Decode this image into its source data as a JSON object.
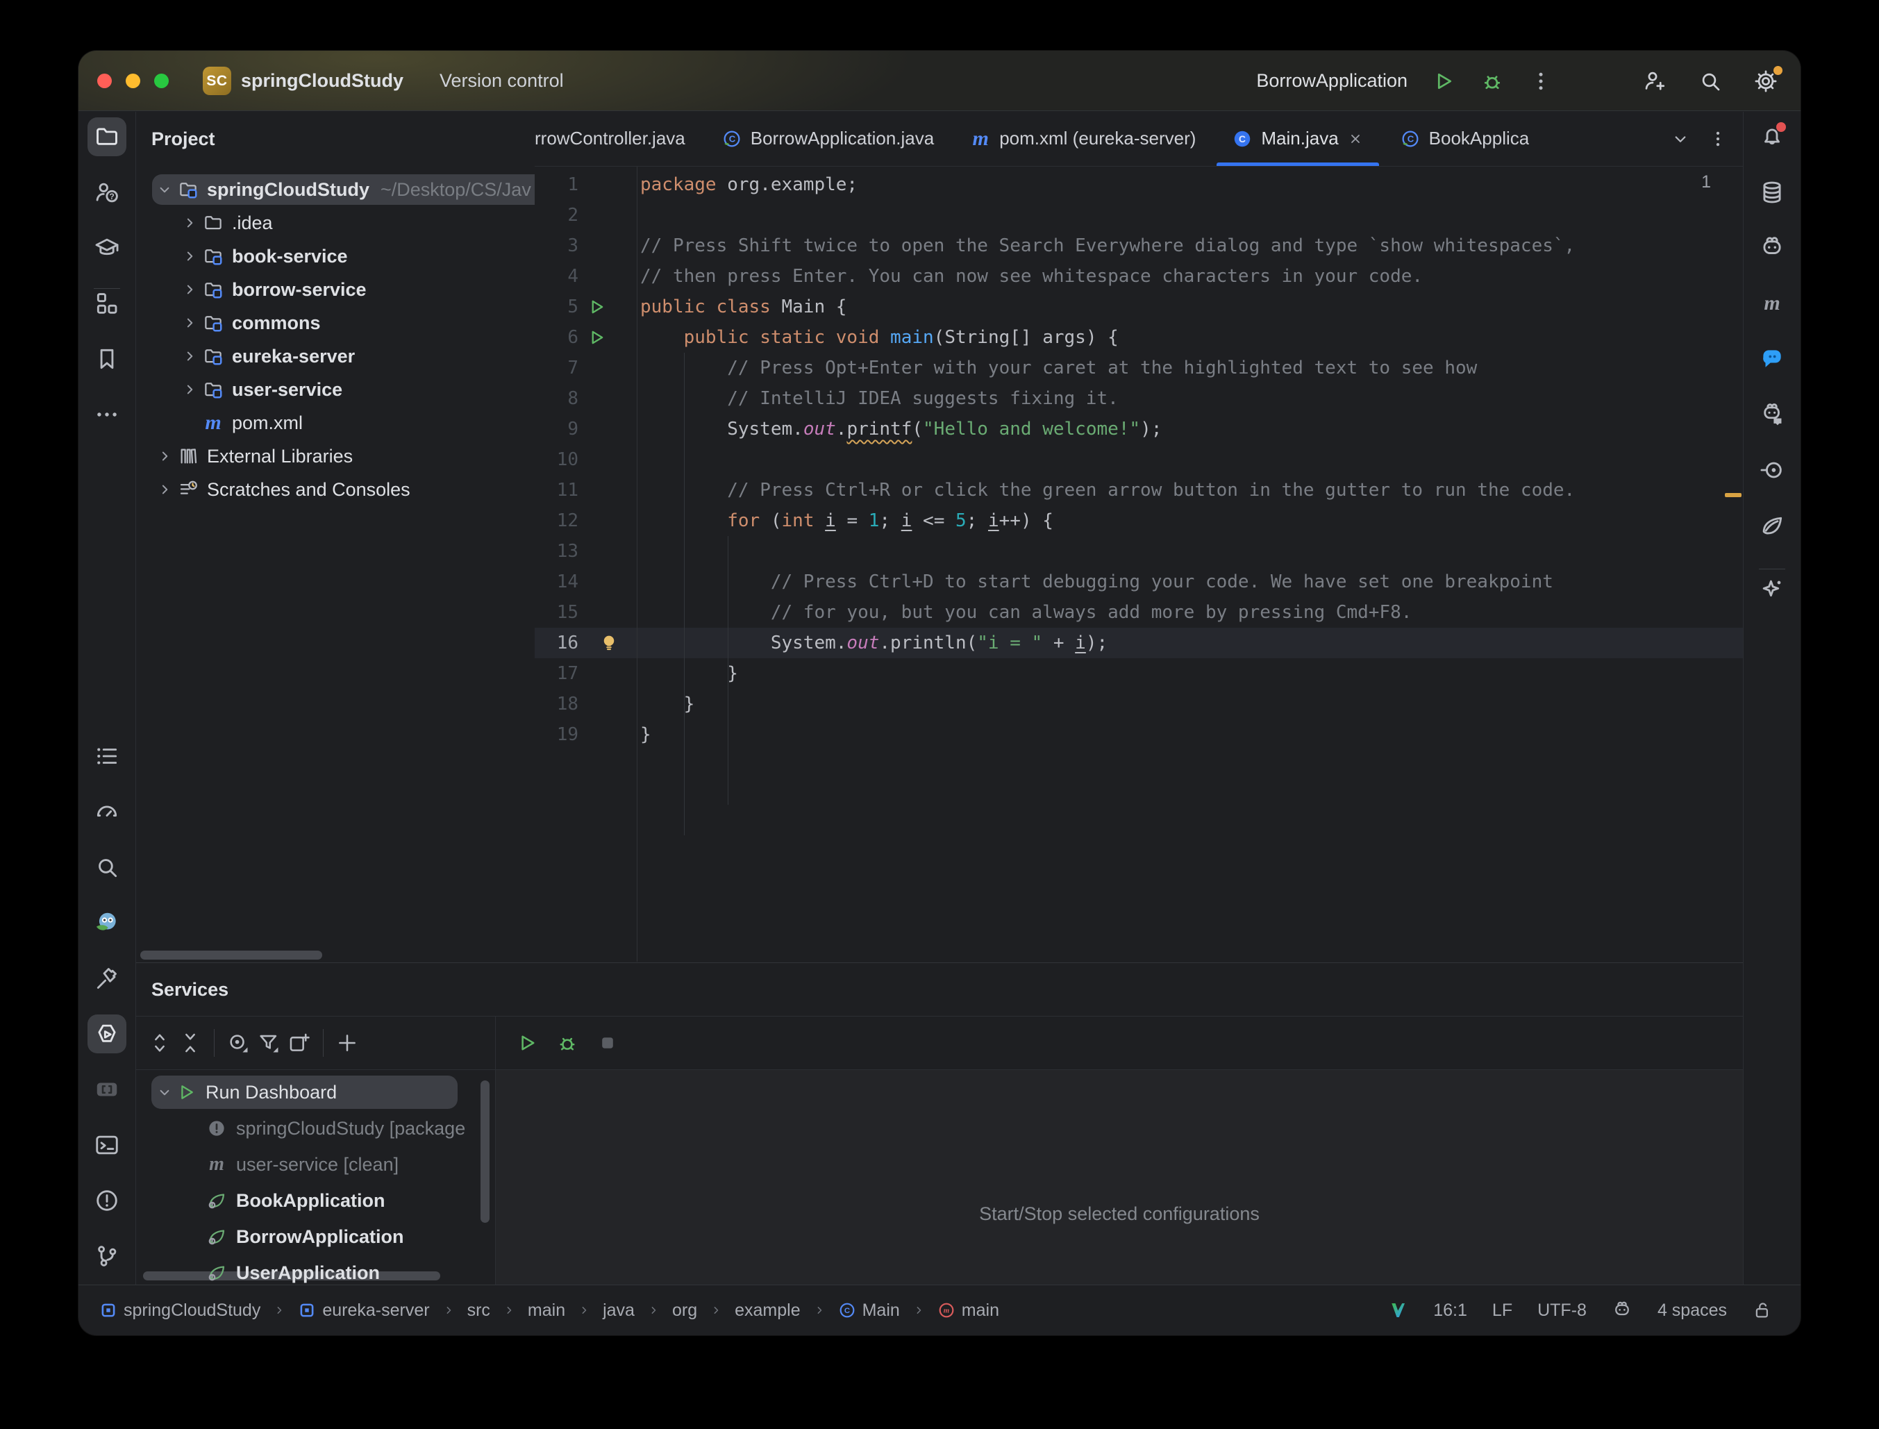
{
  "title_bar": {
    "traffic_lights": [
      {
        "name": "close",
        "color": "#ff5f57"
      },
      {
        "name": "minimize",
        "color": "#febc2e"
      },
      {
        "name": "zoom",
        "color": "#28c840"
      }
    ],
    "project_badge": "SC",
    "project_name": "springCloudStudy",
    "version_control_label": "Version control",
    "run_config_name": "BorrowApplication",
    "run_controls": [
      "play",
      "debug",
      "kebab"
    ],
    "right_controls": [
      "user-plus",
      "search",
      "settings"
    ]
  },
  "left_strip": {
    "top": [
      {
        "icon": "folder",
        "active": true
      },
      {
        "icon": "user-question"
      },
      {
        "icon": "graduation-cap"
      },
      {
        "icon": "divider"
      },
      {
        "icon": "structure"
      },
      {
        "icon": "bookmark"
      },
      {
        "icon": "more"
      }
    ],
    "bottom": [
      {
        "icon": "todo-list"
      },
      {
        "icon": "gauge"
      },
      {
        "icon": "find"
      },
      {
        "icon": "owl-plugin"
      },
      {
        "icon": "build-hammer"
      },
      {
        "icon": "services-play",
        "active": true
      },
      {
        "icon": "brackets"
      },
      {
        "icon": "terminal"
      },
      {
        "icon": "problems"
      },
      {
        "icon": "git-branch"
      }
    ]
  },
  "right_strip": {
    "icons": [
      {
        "icon": "notifications-bell",
        "badge": "#e35252"
      },
      {
        "icon": "database"
      },
      {
        "icon": "ai-robot"
      },
      {
        "icon": "maven"
      },
      {
        "icon": "chat-bubble",
        "accent": "#2e9ef7"
      },
      {
        "icon": "robot-chat"
      },
      {
        "icon": "endpoints"
      },
      {
        "icon": "spring-leaf-outline"
      },
      {
        "icon": "divider"
      },
      {
        "icon": "ai-sparkle"
      }
    ]
  },
  "project_panel": {
    "header": "Project",
    "tree": [
      {
        "label": "springCloudStudy",
        "path": "~/Desktop/CS/Jav",
        "icon": "module-folder",
        "chevron": "down",
        "selected": true,
        "bold": true,
        "indent": 0
      },
      {
        "label": ".idea",
        "icon": "plain-folder",
        "chevron": "right",
        "indent": 1
      },
      {
        "label": "book-service",
        "icon": "module-folder",
        "chevron": "right",
        "bold": true,
        "indent": 1
      },
      {
        "label": "borrow-service",
        "icon": "module-folder",
        "chevron": "right",
        "bold": true,
        "indent": 1
      },
      {
        "label": "commons",
        "icon": "module-folder",
        "chevron": "right",
        "bold": true,
        "indent": 1
      },
      {
        "label": "eureka-server",
        "icon": "module-folder",
        "chevron": "right",
        "bold": true,
        "indent": 1
      },
      {
        "label": "user-service",
        "icon": "module-folder",
        "chevron": "right",
        "bold": true,
        "indent": 1
      },
      {
        "label": "pom.xml",
        "icon": "maven-file",
        "chevron": "none",
        "indent": 1
      },
      {
        "label": "External Libraries",
        "icon": "library",
        "chevron": "right",
        "indent": 0
      },
      {
        "label": "Scratches and Consoles",
        "icon": "scratches",
        "chevron": "right",
        "indent": 0
      }
    ]
  },
  "editor": {
    "tabs": [
      {
        "label": "rrowController.java",
        "icon": null,
        "clipped": "left"
      },
      {
        "label": "BorrowApplication.java",
        "icon": "spring-class"
      },
      {
        "label": "pom.xml (eureka-server)",
        "icon": "maven-file"
      },
      {
        "label": "Main.java",
        "icon": "java-class",
        "active": true,
        "closable": true
      },
      {
        "label": "BookApplica",
        "icon": "spring-class",
        "clipped": "right"
      }
    ],
    "tab_controls": [
      "chevron-down",
      "kebab"
    ],
    "warning_count": "1",
    "code": {
      "current_line": 16,
      "lines": [
        {
          "n": 1,
          "t": [
            [
              "kw",
              "package"
            ],
            [
              "pl",
              " org.example;"
            ]
          ]
        },
        {
          "n": 2,
          "t": []
        },
        {
          "n": 3,
          "t": [
            [
              "cm",
              "// Press Shift twice to open the Search Everywhere dialog and type `show whitespaces`,"
            ]
          ]
        },
        {
          "n": 4,
          "t": [
            [
              "cm",
              "// then press Enter. You can now see whitespace characters in your code."
            ]
          ]
        },
        {
          "n": 5,
          "g": "run",
          "t": [
            [
              "kw",
              "public class"
            ],
            [
              "pl",
              " Main {"
            ]
          ]
        },
        {
          "n": 6,
          "g": "run",
          "t": [
            [
              "pl",
              "    "
            ],
            [
              "kw",
              "public static void"
            ],
            [
              "pl",
              " "
            ],
            [
              "fn",
              "main"
            ],
            [
              "pl",
              "(String[] args) {"
            ]
          ]
        },
        {
          "n": 7,
          "t": [
            [
              "pl",
              "        "
            ],
            [
              "cm",
              "// Press Opt+Enter with your caret at the highlighted text to see how"
            ]
          ]
        },
        {
          "n": 8,
          "t": [
            [
              "pl",
              "        "
            ],
            [
              "cm",
              "// IntelliJ IDEA suggests fixing it."
            ]
          ]
        },
        {
          "n": 9,
          "t": [
            [
              "pl",
              "        System."
            ],
            [
              "fd",
              "out"
            ],
            [
              "pl",
              "."
            ],
            [
              "wv",
              "printf"
            ],
            [
              "pl",
              "("
            ],
            [
              "st",
              "\"Hello and welcome!\""
            ],
            [
              "pl",
              ");"
            ]
          ]
        },
        {
          "n": 10,
          "t": []
        },
        {
          "n": 11,
          "t": [
            [
              "pl",
              "        "
            ],
            [
              "cm",
              "// Press Ctrl+R or click the green arrow button in the gutter to run the code."
            ]
          ]
        },
        {
          "n": 12,
          "t": [
            [
              "pl",
              "        "
            ],
            [
              "kw",
              "for"
            ],
            [
              "pl",
              " ("
            ],
            [
              "kw",
              "int"
            ],
            [
              "pl",
              " "
            ],
            [
              "va",
              "i"
            ],
            [
              "pl",
              " = "
            ],
            [
              "nm",
              "1"
            ],
            [
              "pl",
              "; "
            ],
            [
              "va",
              "i"
            ],
            [
              "pl",
              " <= "
            ],
            [
              "nm",
              "5"
            ],
            [
              "pl",
              "; "
            ],
            [
              "va",
              "i"
            ],
            [
              "pl",
              "++) {"
            ]
          ]
        },
        {
          "n": 13,
          "t": []
        },
        {
          "n": 14,
          "t": [
            [
              "pl",
              "            "
            ],
            [
              "cm",
              "// Press Ctrl+D to start debugging your code. We have set one breakpoint"
            ]
          ]
        },
        {
          "n": 15,
          "t": [
            [
              "pl",
              "            "
            ],
            [
              "cm",
              "// for you, but you can always add more by pressing Cmd+F8."
            ]
          ]
        },
        {
          "n": 16,
          "g": "bulb",
          "t": [
            [
              "pl",
              "            System."
            ],
            [
              "fd",
              "out"
            ],
            [
              "pl",
              ".println("
            ],
            [
              "st",
              "\"i = \""
            ],
            [
              "pl",
              " + "
            ],
            [
              "va",
              "i"
            ],
            [
              "pl",
              ");"
            ]
          ]
        },
        {
          "n": 17,
          "t": [
            [
              "pl",
              "        }"
            ]
          ]
        },
        {
          "n": 18,
          "t": [
            [
              "pl",
              "    }"
            ]
          ]
        },
        {
          "n": 19,
          "t": [
            [
              "pl",
              "}"
            ]
          ]
        }
      ]
    }
  },
  "services_panel": {
    "title": "Services",
    "toolbar_icons": [
      "expand-all",
      "collapse-all",
      "separator",
      "view-options",
      "filter",
      "add-tab",
      "separator",
      "add"
    ],
    "run_controls": [
      "play",
      "debug",
      "stop"
    ],
    "tree": [
      {
        "label": "Run Dashboard",
        "icon": "run-play",
        "chevron": "down",
        "selected": true
      },
      {
        "label": "springCloudStudy [package",
        "icon": "excl-circle",
        "dim": true
      },
      {
        "label": "user-service [clean]",
        "icon": "maven-gray",
        "dim": true
      },
      {
        "label": "BookApplication",
        "icon": "spring-boot",
        "bold": true
      },
      {
        "label": "BorrowApplication",
        "icon": "spring-boot",
        "bold": true
      },
      {
        "label": "UserApplication",
        "icon": "spring-boot",
        "bold": true
      }
    ],
    "empty_state": "Start/Stop selected configurations"
  },
  "status_bar": {
    "breadcrumbs": [
      {
        "label": "springCloudStudy",
        "icon": "module-square"
      },
      {
        "label": "eureka-server",
        "icon": "module-square"
      },
      {
        "label": "src"
      },
      {
        "label": "main"
      },
      {
        "label": "java"
      },
      {
        "label": "org"
      },
      {
        "label": "example"
      },
      {
        "label": "Main",
        "icon": "class-circle"
      },
      {
        "label": "main",
        "icon": "method-circle"
      }
    ],
    "right_items": [
      {
        "icon": "v-logo"
      },
      {
        "label": "16:1"
      },
      {
        "label": "LF"
      },
      {
        "label": "UTF-8"
      },
      {
        "icon": "ai-robot"
      },
      {
        "label": "4 spaces"
      },
      {
        "icon": "unlock"
      }
    ]
  }
}
